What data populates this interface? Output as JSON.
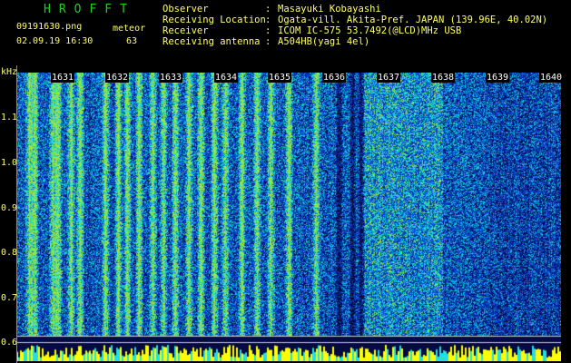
{
  "header": {
    "logo": "HROFFT",
    "filename": "09191630.png",
    "timestamp": "02.09.19 16:30",
    "meteor_label": "meteor",
    "meteor_count": "63"
  },
  "info": [
    {
      "label": "Observer",
      "value": "Masayuki Kobayashi"
    },
    {
      "label": "Receiving Location",
      "value": "Ogata-vill. Akita-Pref. JAPAN (139.96E, 40.02N)"
    },
    {
      "label": "Receiver",
      "value": "ICOM IC-575 53.7492(@LCD)MHz USB"
    },
    {
      "label": "Receiving antenna",
      "value": "A504HB(yagi 4el)"
    }
  ],
  "axis": {
    "unit": "kHz",
    "ticks": [
      "1.1",
      "1.0",
      "0.9",
      "0.8",
      "0.7",
      "0.6"
    ]
  },
  "time_marks": [
    "1631",
    "1632",
    "1633",
    "1634",
    "1635",
    "1636",
    "1637",
    "1638",
    "1639",
    "1640"
  ],
  "colors": {
    "background": "#000000",
    "text": "#ffff66",
    "logo": "#22cc22",
    "noise_dark": "#0a1a6e",
    "noise_mid": "#1e4fd0",
    "noise_hi": "#22d0c8",
    "meteor": "#c8f03c",
    "baseline": "#ffff00"
  }
}
